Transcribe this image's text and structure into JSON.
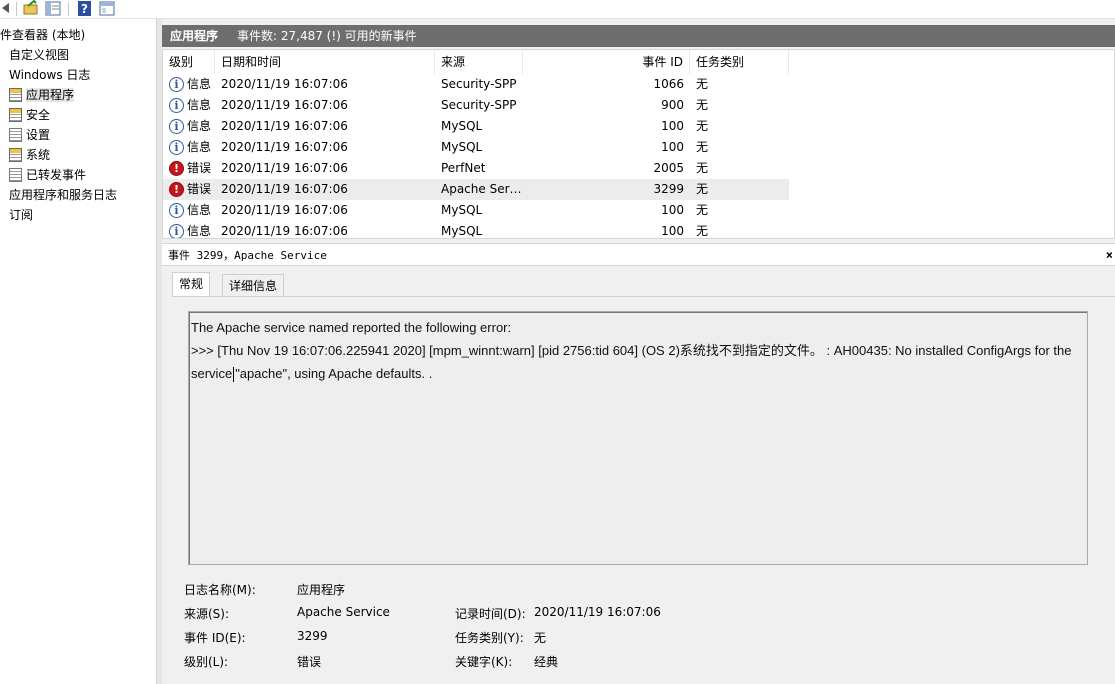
{
  "tree": {
    "root": "件查看器 (本地)",
    "custom_views": "自定义视图",
    "windows_logs": "Windows 日志",
    "items": [
      "应用程序",
      "安全",
      "设置",
      "系统",
      "已转发事件"
    ],
    "app_service_logs": "应用程序和服务日志",
    "subscriptions": "订阅"
  },
  "header": {
    "title": "应用程序",
    "count": "事件数: 27,487 (!) 可用的新事件"
  },
  "columns": [
    "级别",
    "日期和时间",
    "来源",
    "事件 ID",
    "任务类别"
  ],
  "rows": [
    {
      "icon": "info-icon",
      "level": "信息",
      "datetime": "2020/11/19 16:07:06",
      "source": "Security-SPP",
      "event_id": "1066",
      "task": "无"
    },
    {
      "icon": "info-icon",
      "level": "信息",
      "datetime": "2020/11/19 16:07:06",
      "source": "Security-SPP",
      "event_id": "900",
      "task": "无"
    },
    {
      "icon": "info-icon",
      "level": "信息",
      "datetime": "2020/11/19 16:07:06",
      "source": "MySQL",
      "event_id": "100",
      "task": "无"
    },
    {
      "icon": "info-icon",
      "level": "信息",
      "datetime": "2020/11/19 16:07:06",
      "source": "MySQL",
      "event_id": "100",
      "task": "无"
    },
    {
      "icon": "error-icon",
      "level": "错误",
      "datetime": "2020/11/19 16:07:06",
      "source": "PerfNet",
      "event_id": "2005",
      "task": "无"
    },
    {
      "icon": "error-icon",
      "level": "错误",
      "datetime": "2020/11/19 16:07:06",
      "source": "Apache Ser…",
      "event_id": "3299",
      "task": "无"
    },
    {
      "icon": "info-icon",
      "level": "信息",
      "datetime": "2020/11/19 16:07:06",
      "source": "MySQL",
      "event_id": "100",
      "task": "无"
    },
    {
      "icon": "info-icon",
      "level": "信息",
      "datetime": "2020/11/19 16:07:06",
      "source": "MySQL",
      "event_id": "100",
      "task": "无"
    }
  ],
  "detail": {
    "title": "事件 3299，Apache Service",
    "tabs": [
      "常规",
      "详细信息"
    ],
    "message": {
      "line1": "The Apache service named  reported the following error:",
      "line2": ">>> [Thu Nov 19 16:07:06.225941 2020] [mpm_winnt:warn] [pid 2756:tid 604] (OS 2)系统找不到指定的文件。  : AH00435: No installed ConfigArgs for the",
      "line3a": "service",
      "line3b": "\"apache\", using Apache defaults.     ."
    },
    "props": {
      "log_name_label": "日志名称(M):",
      "log_name": "应用程序",
      "source_label": "来源(S):",
      "source": "Apache Service",
      "logged_label": "记录时间(D):",
      "logged": "2020/11/19 16:07:06",
      "event_id_label": "事件 ID(E):",
      "event_id": "3299",
      "task_label": "任务类别(Y):",
      "task": "无",
      "level_label": "级别(L):",
      "level": "错误",
      "keywords_label": "关键字(K):",
      "keywords": "经典"
    }
  },
  "colors": {
    "header_bg": "#6e6e6e",
    "error_red": "#c4161c",
    "info_blue": "#2e5a9c",
    "selected_row": "#ececec"
  }
}
